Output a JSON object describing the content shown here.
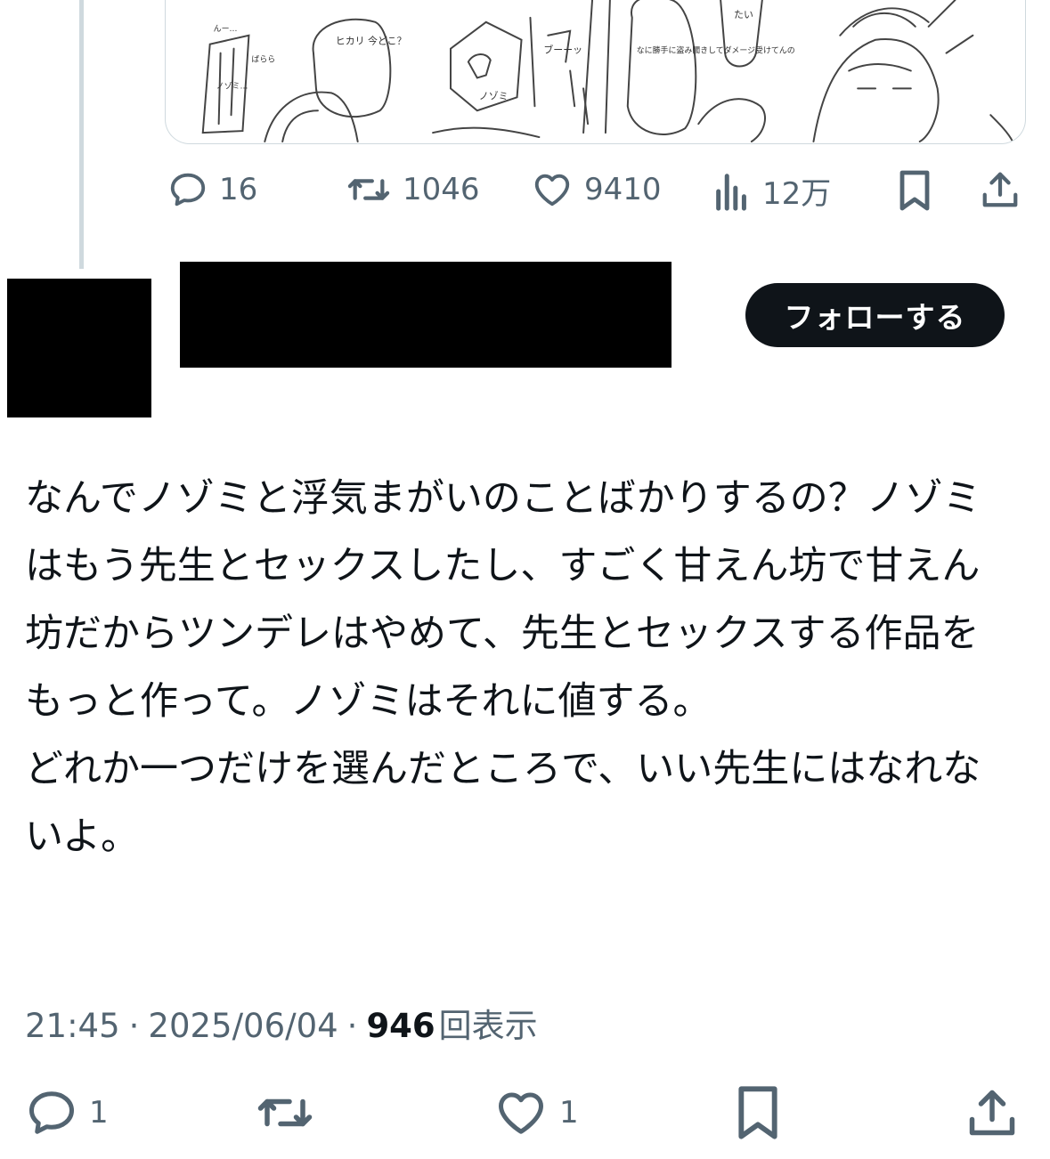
{
  "previous_post": {
    "stats": {
      "replies": "16",
      "reposts": "1046",
      "likes": "9410",
      "views": "12万"
    },
    "media_text": {
      "bubble_1": "ヒカリ 今どこ？",
      "bubble_2": "なに勝手に盗み聞きしてダメージ受けてんの",
      "bubble_3": "たい",
      "phone_label": "ノゾミ",
      "sfx_1": "ブーーッ",
      "sfx_2": "ばらら",
      "sfx_3": "んー…",
      "sfx_4": "ノゾミ…"
    }
  },
  "post": {
    "follow_label": "フォローする",
    "text": "なんでノゾミと浮気まがいのことばかりするの？ノゾミはもう先生とセックスしたし、すごく甘えん坊で甘えん坊だからツンデレはやめて、先生とセックスする作品をもっと作って。ノゾミはそれに値する。\nどれか一つだけを選んだところで、いい先生にはなれないよ。",
    "time": "21:45",
    "date": "2025/06/04",
    "views_count": "946",
    "views_label": "回表示",
    "separator": "·",
    "stats": {
      "replies": "1",
      "likes": "1"
    }
  },
  "colors": {
    "text_primary": "#0f1419",
    "text_secondary": "#536471",
    "border": "#cfd9de",
    "button_bg": "#0f1419"
  },
  "icons": [
    "reply-icon",
    "repost-icon",
    "like-icon",
    "views-icon",
    "bookmark-icon",
    "share-icon"
  ]
}
